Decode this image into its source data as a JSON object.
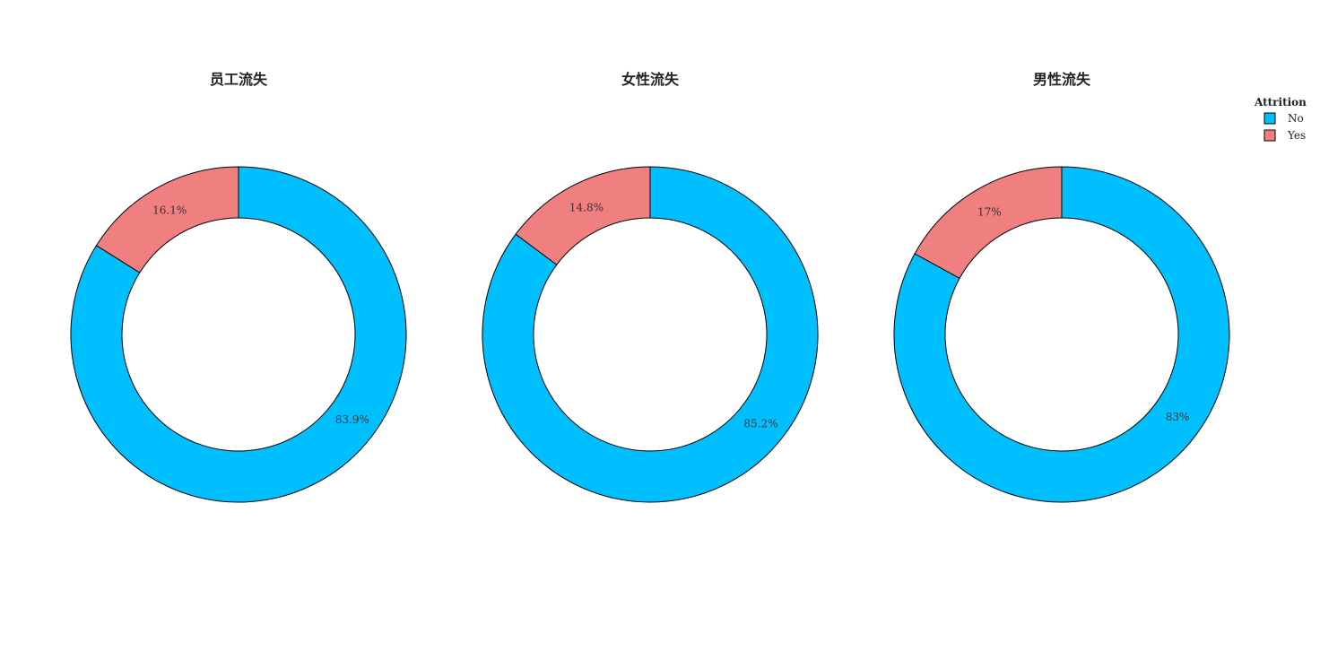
{
  "chart_data": [
    {
      "type": "pie",
      "title": "员工流失",
      "categories": [
        "No",
        "Yes"
      ],
      "values": [
        83.9,
        16.1
      ],
      "labels": [
        "83.9%",
        "16.1%"
      ]
    },
    {
      "type": "pie",
      "title": "女性流失",
      "categories": [
        "No",
        "Yes"
      ],
      "values": [
        85.2,
        14.8
      ],
      "labels": [
        "85.2%",
        "14.8%"
      ]
    },
    {
      "type": "pie",
      "title": "男性流失",
      "categories": [
        "No",
        "Yes"
      ],
      "values": [
        83,
        17
      ],
      "labels": [
        "83%",
        "17%"
      ]
    }
  ],
  "legend": {
    "title": "Attrition",
    "placement": "top-right",
    "items": [
      {
        "label": "No",
        "color": "#00BFFF"
      },
      {
        "label": "Yes",
        "color": "#F08080"
      }
    ]
  },
  "colors": {
    "No": "#00BFFF",
    "Yes": "#F08080",
    "outline": "#000000"
  }
}
